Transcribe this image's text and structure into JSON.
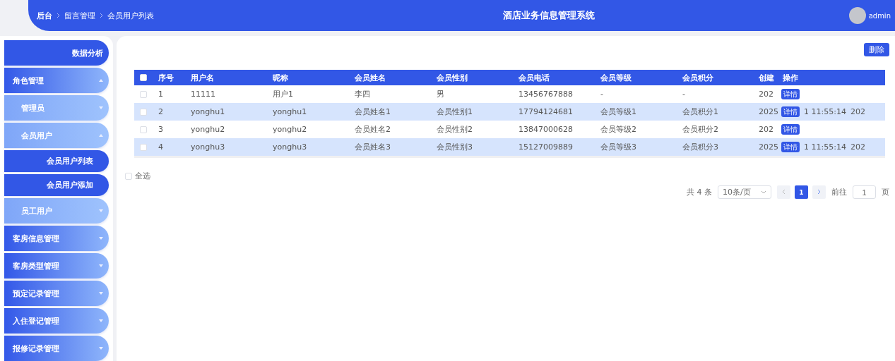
{
  "header": {
    "breadcrumb": [
      "后台",
      "留言管理",
      "会员用户列表"
    ],
    "title": "酒店业务信息管理系统",
    "user": "admin"
  },
  "sidebar": {
    "items": [
      {
        "kind": "top",
        "label": "数据分析"
      },
      {
        "kind": "menu",
        "label": "角色管理",
        "expanded": true,
        "children": [
          {
            "kind": "sub",
            "label": "管理员",
            "expanded": false
          },
          {
            "kind": "sub",
            "label": "会员用户",
            "expanded": true,
            "children": [
              {
                "kind": "leaf",
                "label": "会员用户列表"
              },
              {
                "kind": "leaf",
                "label": "会员用户添加"
              }
            ]
          },
          {
            "kind": "sub",
            "label": "员工用户",
            "expanded": false
          }
        ]
      },
      {
        "kind": "menu",
        "label": "客房信息管理",
        "expanded": false
      },
      {
        "kind": "menu",
        "label": "客房类型管理",
        "expanded": false
      },
      {
        "kind": "menu",
        "label": "预定记录管理",
        "expanded": false
      },
      {
        "kind": "menu",
        "label": "入住登记管理",
        "expanded": false
      },
      {
        "kind": "menu",
        "label": "报修记录管理",
        "expanded": false
      }
    ]
  },
  "toolbar": {
    "delete_button": "删除"
  },
  "table": {
    "header_checked": false,
    "columns": [
      "序号",
      "用户名",
      "昵称",
      "会员姓名",
      "会员性别",
      "会员电话",
      "会员等级",
      "会员积分",
      "创建",
      "操作"
    ],
    "rows": [
      {
        "checked": false,
        "highlighted": false,
        "cells": [
          "1",
          "11111",
          "用户1",
          "李四",
          "男",
          "13456767888",
          "-",
          "-",
          "202"
        ],
        "action": "详情"
      },
      {
        "checked": false,
        "highlighted": true,
        "cells": [
          "2",
          "yonghu1",
          "yonghu1",
          "会员姓名1",
          "会员性别1",
          "17794124681",
          "会员等级1",
          "会员积分1",
          "2025"
        ],
        "action": "详情",
        "after_action": "1 11:55:14",
        "tail": "202"
      },
      {
        "checked": false,
        "highlighted": false,
        "cells": [
          "3",
          "yonghu2",
          "yonghu2",
          "会员姓名2",
          "会员性别2",
          "13847000628",
          "会员等级2",
          "会员积分2",
          "202"
        ],
        "action": "详情"
      },
      {
        "checked": false,
        "highlighted": true,
        "cells": [
          "4",
          "yonghu3",
          "yonghu3",
          "会员姓名3",
          "会员性别3",
          "15127009889",
          "会员等级3",
          "会员积分3",
          "2025"
        ],
        "action": "详情",
        "after_action": "1 11:55:14",
        "tail": "202"
      }
    ]
  },
  "select_all": {
    "label": "全选",
    "checked": false
  },
  "pagination": {
    "total": "共 4 条",
    "page_size": "10条/页",
    "pages": [
      {
        "label": "1",
        "selected": true
      }
    ],
    "goto_label": "前往",
    "goto_value": "1",
    "page_suffix": "页"
  }
}
